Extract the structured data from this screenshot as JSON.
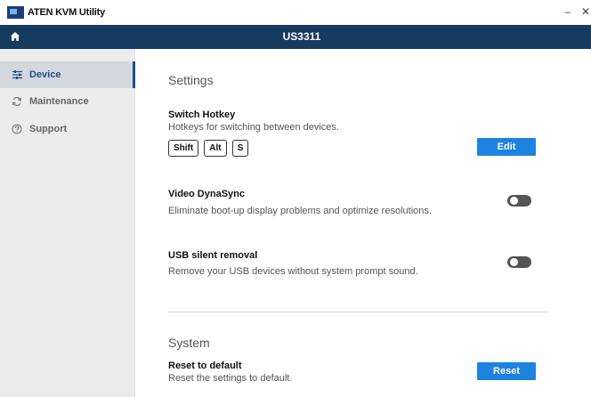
{
  "window": {
    "app_title": "ATEN KVM Utility",
    "minimize_glyph": "–",
    "close_glyph": "✕"
  },
  "header": {
    "device_name": "US3311",
    "home_icon": "home-icon"
  },
  "sidebar": {
    "items": [
      {
        "label": "Device",
        "icon": "sliders-icon",
        "active": true
      },
      {
        "label": "Maintenance",
        "icon": "refresh-icon",
        "active": false
      },
      {
        "label": "Support",
        "icon": "help-icon",
        "active": false
      }
    ]
  },
  "settings": {
    "title": "Settings",
    "switch_hotkey": {
      "title": "Switch Hotkey",
      "description": "Hotkeys for switching between devices.",
      "keys": [
        "Shift",
        "Alt",
        "S"
      ],
      "edit_label": "Edit"
    },
    "video_dynasync": {
      "title": "Video DynaSync",
      "description": "Eliminate boot-up display problems and optimize resolutions.",
      "enabled": false
    },
    "usb_silent_removal": {
      "title": "USB silent removal",
      "description": "Remove your USB devices without system prompt sound.",
      "enabled": false
    }
  },
  "system": {
    "title": "System",
    "reset": {
      "title": "Reset to default",
      "description": "Reset the settings to default.",
      "button_label": "Reset"
    }
  },
  "colors": {
    "header_bg": "#173a5f",
    "accent": "#1d82e0",
    "active_nav": "#1d4f86",
    "sidebar_bg": "#ececec"
  }
}
